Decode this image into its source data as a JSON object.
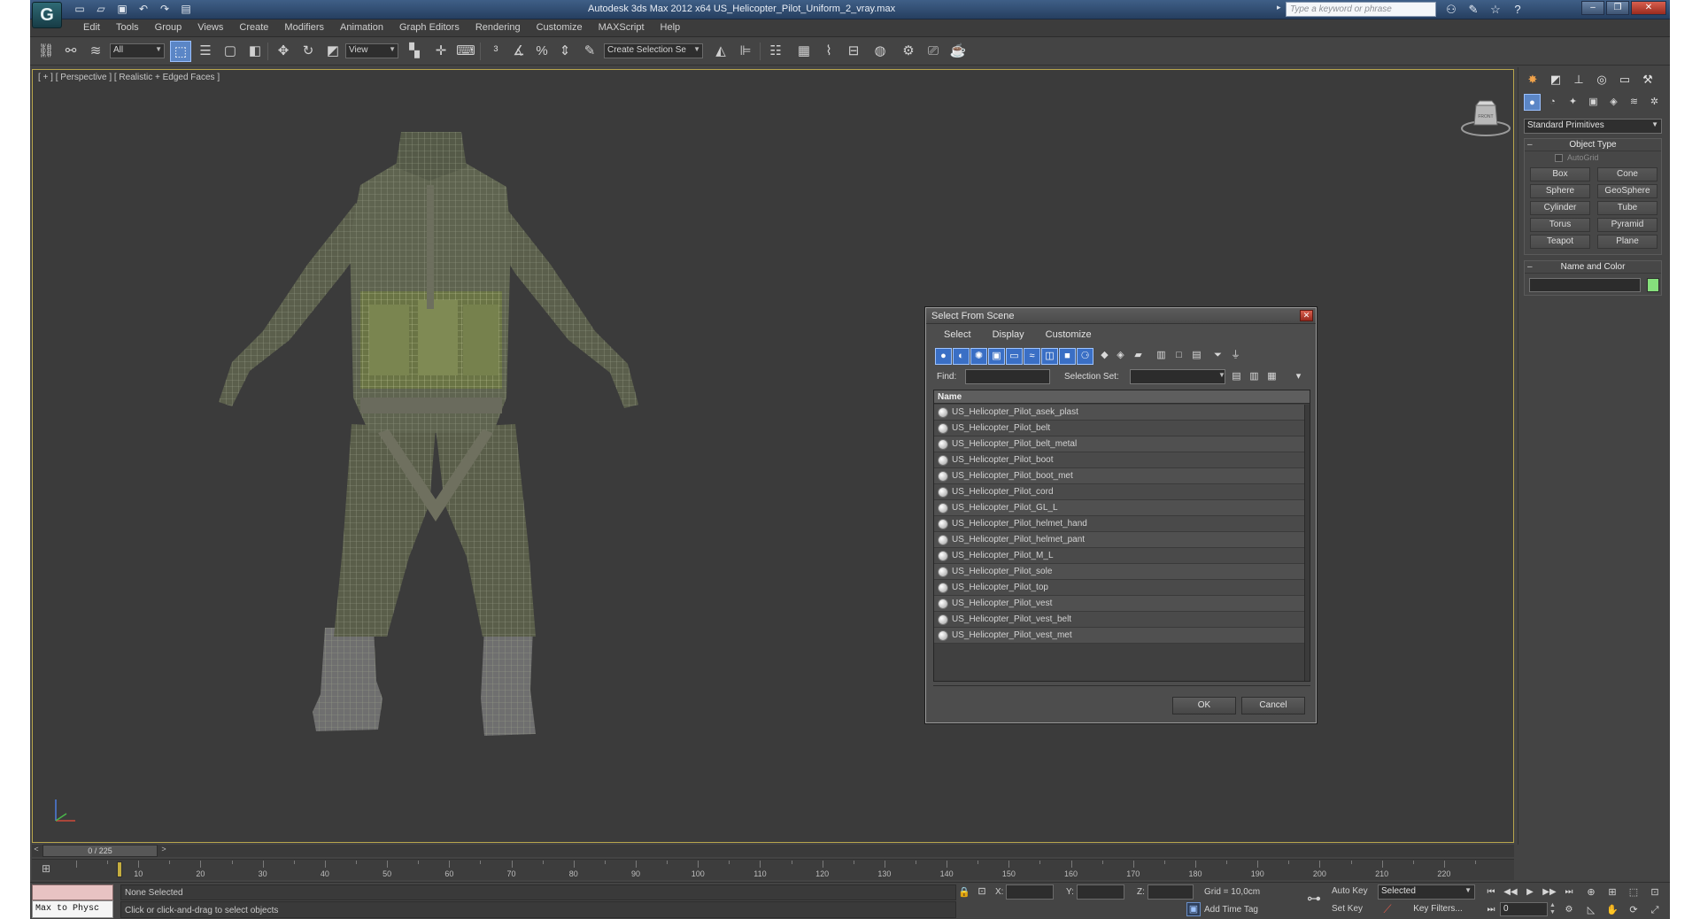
{
  "titlebar": {
    "app_logo": "G",
    "title": "Autodesk 3ds Max  2012 x64      US_Helicopter_Pilot_Uniform_2_vray.max",
    "search_placeholder": "Type a keyword or phrase",
    "quick_access": [
      "new-icon",
      "open-icon",
      "save-icon",
      "undo-icon",
      "redo-icon",
      "project-icon"
    ],
    "icons": [
      "binoculars-icon",
      "help-tools-icon",
      "star-icon",
      "help-icon"
    ]
  },
  "menu": [
    "Edit",
    "Tools",
    "Group",
    "Views",
    "Create",
    "Modifiers",
    "Animation",
    "Graph Editors",
    "Rendering",
    "Customize",
    "MAXScript",
    "Help"
  ],
  "toolbar": {
    "selection_filter": "All",
    "reference_coord": "View",
    "named_selection": "Create Selection Se"
  },
  "viewport": {
    "label": "[ + ] [ Perspective ] [ Realistic + Edged Faces ]",
    "viewcube_label": "FRONT"
  },
  "dialog": {
    "title": "Select From Scene",
    "menu": [
      "Select",
      "Display",
      "Customize"
    ],
    "find_label": "Find:",
    "selection_set_label": "Selection Set:",
    "column_name": "Name",
    "items": [
      "US_Helicopter_Pilot_asek_plast",
      "US_Helicopter_Pilot_belt",
      "US_Helicopter_Pilot_belt_metal",
      "US_Helicopter_Pilot_boot",
      "US_Helicopter_Pilot_boot_met",
      "US_Helicopter_Pilot_cord",
      "US_Helicopter_Pilot_GL_L",
      "US_Helicopter_Pilot_helmet_hand",
      "US_Helicopter_Pilot_helmet_pant",
      "US_Helicopter_Pilot_M_L",
      "US_Helicopter_Pilot_sole",
      "US_Helicopter_Pilot_top",
      "US_Helicopter_Pilot_vest",
      "US_Helicopter_Pilot_vest_belt",
      "US_Helicopter_Pilot_vest_met"
    ],
    "ok_label": "OK",
    "cancel_label": "Cancel"
  },
  "command_panel": {
    "dropdown": "Standard Primitives",
    "object_type_title": "Object Type",
    "autogrid_label": "AutoGrid",
    "primitives": [
      "Box",
      "Cone",
      "Sphere",
      "GeoSphere",
      "Cylinder",
      "Tube",
      "Torus",
      "Pyramid",
      "Teapot",
      "Plane"
    ],
    "name_color_title": "Name and Color",
    "swatch_color": "#86e07c"
  },
  "timeline": {
    "frame_counter": "0 / 225",
    "ticks": [
      "10",
      "20",
      "30",
      "40",
      "50",
      "60",
      "70",
      "80",
      "90",
      "100",
      "110",
      "120",
      "130",
      "140",
      "150",
      "160",
      "170",
      "180",
      "190",
      "200",
      "210",
      "220"
    ]
  },
  "statusbar": {
    "maxscript": "Max to Physc",
    "selection": "None Selected",
    "prompt": "Click or click-and-drag to select objects",
    "x_label": "X:",
    "y_label": "Y:",
    "z_label": "Z:",
    "grid": "Grid = 10,0cm",
    "time_tag": "Add Time Tag",
    "auto_key": "Auto Key",
    "set_key": "Set Key",
    "key_mode": "Selected",
    "key_filters": "Key Filters...",
    "current_frame": "0"
  }
}
